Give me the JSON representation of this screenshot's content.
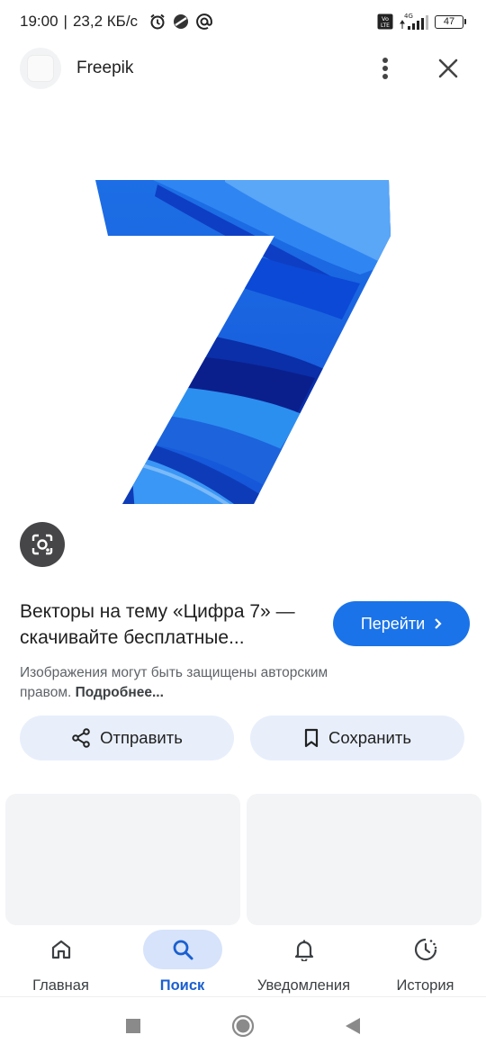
{
  "status_bar": {
    "time": "19:00",
    "separator": "|",
    "speed": "23,2 КБ/с",
    "network": "4G",
    "volte": "Vo LTE",
    "battery": "47"
  },
  "header": {
    "site_name": "Freepik"
  },
  "image": {
    "subject": "7"
  },
  "result": {
    "title": "Векторы на тему «Цифра 7» — скачивайте бесплатные...",
    "visit_label": "Перейти",
    "notice_text": "Изображения могут быть защищены авторским правом.",
    "notice_link": "Подробнее..."
  },
  "actions": {
    "share_label": "Отправить",
    "save_label": "Сохранить"
  },
  "bottom_nav": {
    "items": [
      {
        "label": "Главная",
        "icon": "home-icon"
      },
      {
        "label": "Поиск",
        "icon": "search-icon",
        "active": true
      },
      {
        "label": "Уведомления",
        "icon": "bell-icon"
      },
      {
        "label": "История",
        "icon": "history-icon"
      }
    ]
  },
  "colors": {
    "accent": "#1a73e8",
    "pill_bg": "#e8effb",
    "nav_active_bg": "#d6e3fb"
  }
}
